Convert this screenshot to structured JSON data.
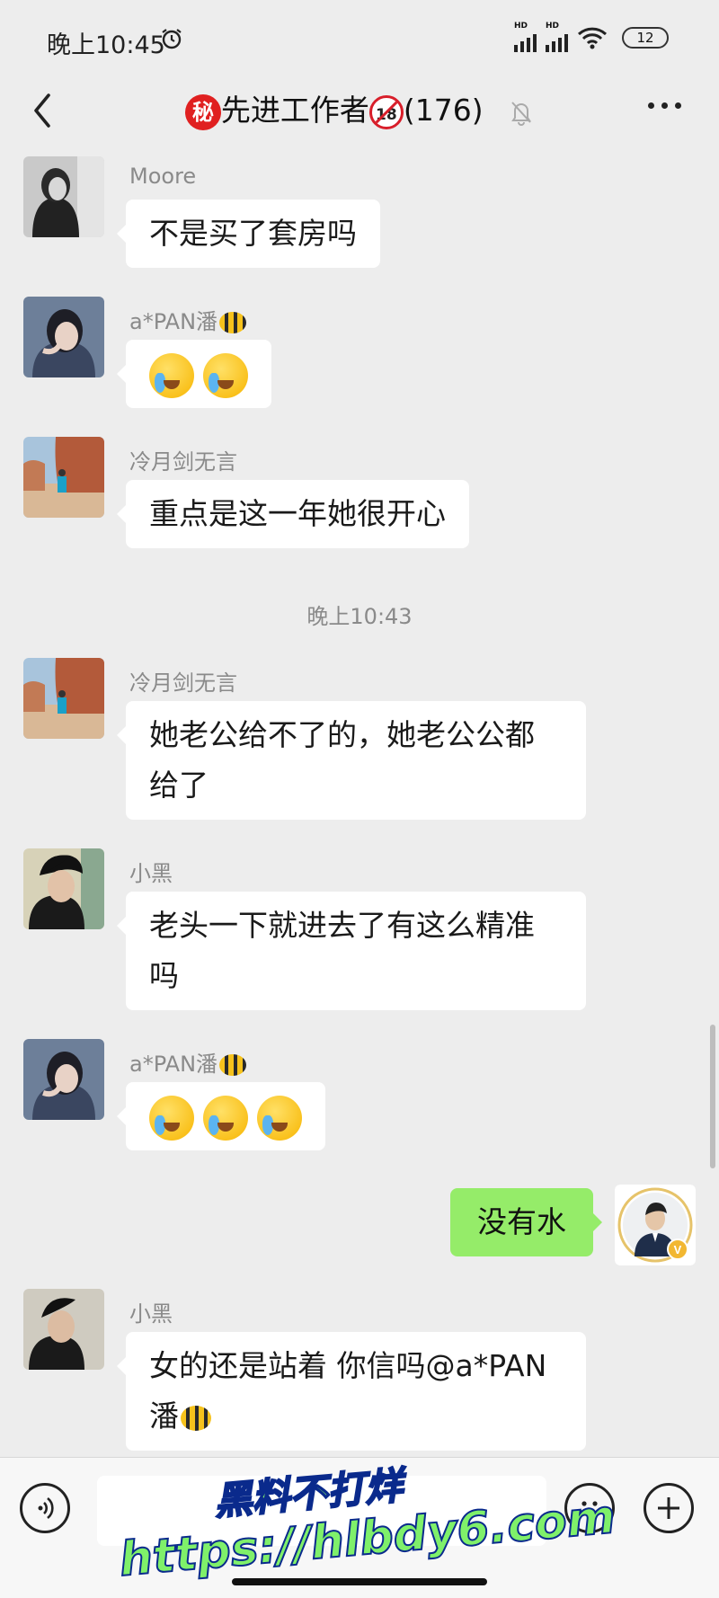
{
  "status_bar": {
    "time": "晚上10:45",
    "network_label": "HD",
    "battery": "12"
  },
  "header": {
    "secret_badge": "秘",
    "title": "先进工作者",
    "age_badge": "18",
    "member_count": "(176)"
  },
  "messages": [
    {
      "sender": "Moore",
      "text": "不是买了套房吗"
    },
    {
      "sender": "a*PAN潘",
      "emoji_count": 2
    },
    {
      "sender": "冷月剑无言",
      "text": "重点是这一年她很开心"
    },
    {
      "timestamp": "晚上10:43"
    },
    {
      "sender": "冷月剑无言",
      "line1": "她老公给不了的，她老公公都",
      "line2": "给了"
    },
    {
      "sender": "小黑",
      "line1": "老头一下就进去了有这么精准",
      "line2": "吗"
    },
    {
      "sender": "a*PAN潘",
      "emoji_count": 3
    },
    {
      "self": true,
      "text": "没有水",
      "verified_badge": "V"
    },
    {
      "sender": "小黑",
      "line1": "女的还是站着 你信吗@a*PAN",
      "line2": "潘"
    }
  ],
  "watermark": {
    "line1": "黑料不打烊",
    "line2": "https://hlbdy6.com"
  },
  "colors": {
    "background": "#ededed",
    "bubble_mine": "#95ec69",
    "bubble_other": "#ffffff"
  }
}
